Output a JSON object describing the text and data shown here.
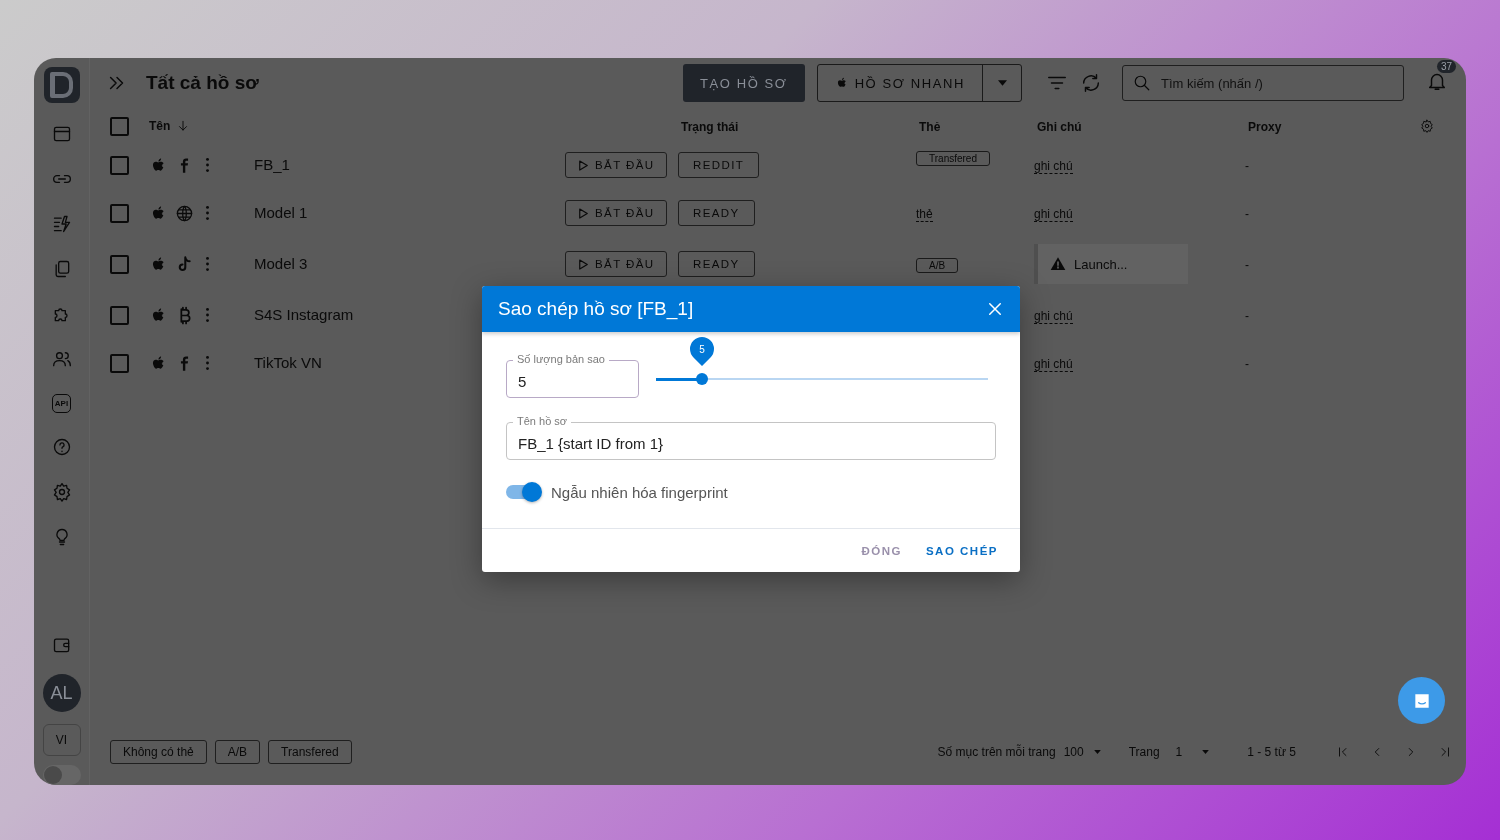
{
  "header": {
    "title": "Tất cả hồ sơ",
    "create_button": "TẠO HỒ SƠ",
    "quick_button": "HỒ SƠ NHANH",
    "search": {
      "placeholder": "Tìm kiếm (nhấn /)"
    },
    "notifications": "37"
  },
  "sidebar": {
    "api_label": "API",
    "avatar": "AL",
    "language": "VI",
    "theme_toggle": {
      "on": false
    }
  },
  "table": {
    "select_all": {
      "checked": false
    },
    "columns": [
      "Tên",
      "Trạng thái",
      "Thẻ",
      "Ghi chú",
      "Proxy"
    ],
    "rows": [
      {
        "checked": false,
        "kind": "facebook",
        "name": "FB_1",
        "start": "BẮT ĐẦU",
        "status": "REDDIT",
        "tag": {
          "kind": "badge",
          "text": "Transfered"
        },
        "note": {
          "kind": "text",
          "text": "ghi chú"
        },
        "proxy": "-"
      },
      {
        "checked": false,
        "kind": "web",
        "name": "Model 1",
        "start": "BẮT ĐẦU",
        "status": "READY",
        "tag": {
          "kind": "text",
          "text": "thẻ"
        },
        "note": {
          "kind": "text",
          "text": "ghi chú"
        },
        "proxy": "-"
      },
      {
        "checked": false,
        "kind": "tiktok",
        "name": "Model 3",
        "start": "BẮT ĐẦU",
        "status": "READY",
        "tag": {
          "kind": "badge",
          "text": "A/B"
        },
        "note": {
          "kind": "warning",
          "text": "Launch..."
        },
        "proxy": "-"
      },
      {
        "checked": false,
        "kind": "bitcoin",
        "name": "S4S Instagram",
        "note": {
          "kind": "text",
          "text": "ghi chú"
        },
        "proxy": "-"
      },
      {
        "checked": false,
        "kind": "facebook",
        "name": "TikTok VN",
        "note": {
          "kind": "text",
          "text": "ghi chú"
        },
        "proxy": "-"
      }
    ]
  },
  "footer": {
    "tag_filters": [
      "Không có thẻ",
      "A/B",
      "Transfered"
    ],
    "per_page_label": "Số mục trên mỗi trang",
    "per_page": "100",
    "page_label": "Trang",
    "page": "1",
    "range": "1 - 5 từ 5"
  },
  "dialog": {
    "title": "Sao chép hồ sơ [FB_1]",
    "count_label": "Số lượng bản sao",
    "count": "5",
    "slider": {
      "level": 0.14,
      "bubble": "5"
    },
    "name_label": "Tên hồ sơ",
    "name": "FB_1 {start ID from 1}",
    "randomize": {
      "label": "Ngẫu nhiên hóa fingerprint",
      "on": true
    },
    "buttons": [
      "ĐÓNG",
      "SAO CHÉP"
    ]
  }
}
